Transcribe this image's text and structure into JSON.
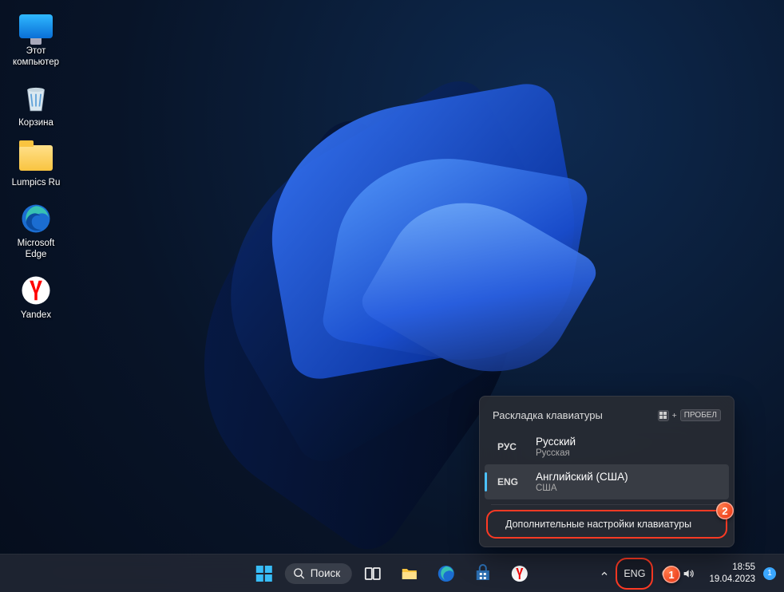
{
  "desktop": {
    "this_pc": "Этот\nкомпьютер",
    "recycle_bin": "Корзина",
    "folder": "Lumpics Ru",
    "edge": "Microsoft\nEdge",
    "yandex": "Yandex"
  },
  "taskbar": {
    "search_label": "Поиск",
    "lang_indicator": "ENG",
    "time": "18:55",
    "date": "19.04.2023",
    "notification_count": "1"
  },
  "flyout": {
    "title": "Раскладка клавиатуры",
    "shortcut_plus": "+",
    "shortcut_key": "ПРОБЕЛ",
    "options": [
      {
        "code": "РУС",
        "name": "Русский",
        "sub": "Русская",
        "selected": false
      },
      {
        "code": "ENG",
        "name": "Английский (США)",
        "sub": "США",
        "selected": true
      }
    ],
    "extra": "Дополнительные настройки клавиатуры"
  },
  "callouts": {
    "one": "1",
    "two": "2"
  }
}
